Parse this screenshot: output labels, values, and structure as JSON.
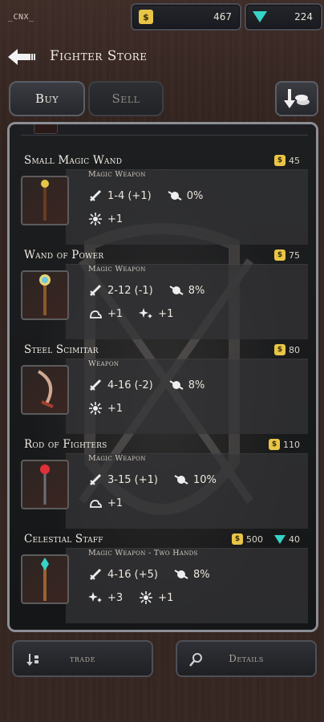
{
  "top_bar": {
    "user_tag": "_CNX_",
    "gold": "467",
    "gems": "224"
  },
  "header": {
    "title": "Fighter Store"
  },
  "tabs": {
    "buy": "Buy",
    "sell": "Sell"
  },
  "items": [
    {
      "name": "Small Magic Wand",
      "price_gold": "45",
      "type": "Magic Weapon",
      "damage": "1-4 (+1)",
      "crit": "0%",
      "bonus1": "+1"
    },
    {
      "name": "Wand of Power",
      "price_gold": "75",
      "type": "Magic Weapon",
      "damage": "2-12 (-1)",
      "crit": "8%",
      "bonus1": "+1",
      "bonus2": "+1"
    },
    {
      "name": "Steel Scimitar",
      "price_gold": "80",
      "type": "Weapon",
      "damage": "4-16 (-2)",
      "crit": "8%",
      "bonus1": "+1"
    },
    {
      "name": "Rod of Fighters",
      "price_gold": "110",
      "type": "Magic Weapon",
      "damage": "3-15 (+1)",
      "crit": "10%",
      "bonus1": "+1"
    },
    {
      "name": "Celestial Staff",
      "price_gold": "500",
      "price_gems": "40",
      "type": "Magic Weapon - Two Hands",
      "damage": "4-16 (+5)",
      "crit": "8%",
      "bonus1": "+3",
      "bonus2": "+1"
    }
  ],
  "bottom": {
    "trade": "trade",
    "details": "Details"
  },
  "colors": {
    "gold": "#e8c547",
    "gem": "#37d3c6",
    "panel_border": "#8c8f96"
  }
}
